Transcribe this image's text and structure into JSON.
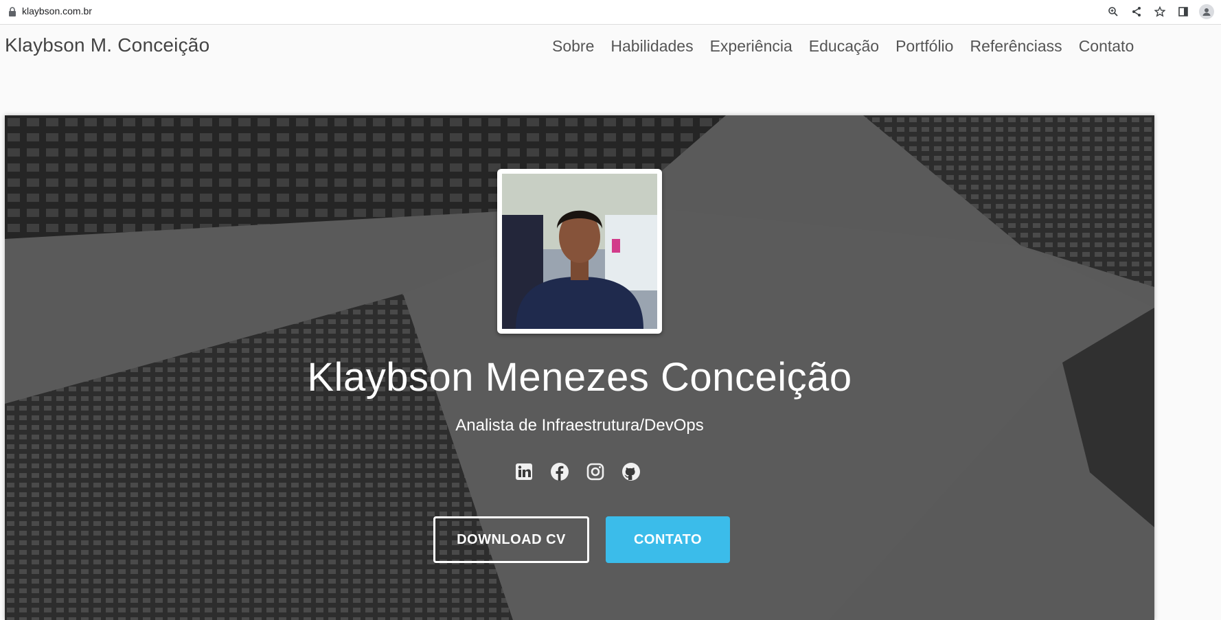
{
  "browser": {
    "url": "klaybson.com.br",
    "icons": [
      "lock-icon",
      "zoom-icon",
      "share-icon",
      "star-icon",
      "side-panel-icon",
      "profile-icon"
    ]
  },
  "navbar": {
    "brand": "Klaybson M. Conceição",
    "links": [
      "Sobre",
      "Habilidades",
      "Experiência",
      "Educação",
      "Portfólio",
      "Referênciass",
      "Contato"
    ]
  },
  "hero": {
    "name": "Klaybson Menezes Conceição",
    "role": "Analista de Infraestrutura/DevOps",
    "socials": [
      "linkedin-icon",
      "facebook-icon",
      "instagram-icon",
      "github-icon"
    ],
    "download_cv": "DOWNLOAD CV",
    "contact": "CONTATO"
  },
  "colors": {
    "accent": "#3bbcea",
    "hero_overlay": "#3a3a3a",
    "nav_text": "#555555"
  }
}
